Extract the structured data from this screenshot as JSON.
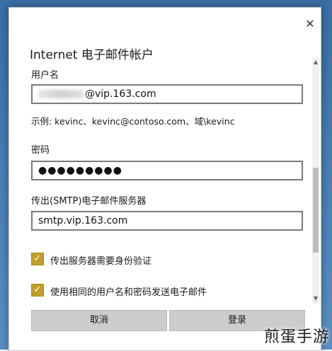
{
  "dialog": {
    "close_icon": "close-icon",
    "title": "Internet 电子邮件帐户"
  },
  "username": {
    "label": "用户名",
    "value_suffix": "@vip.163.com",
    "example": "示例: kevinc、kevinc@contoso.com、域\\kevinc"
  },
  "password": {
    "label": "密码",
    "value": "●●●●●●●●●"
  },
  "smtp": {
    "label": "传出(SMTP)电子邮件服务器",
    "value": "smtp.vip.163.com"
  },
  "options": [
    {
      "label": "传出服务器需要身份验证",
      "checked": true
    },
    {
      "label": "使用相同的用户名和密码发送电子邮件",
      "checked": true
    }
  ],
  "buttons": {
    "cancel": "取消",
    "login": "登录"
  },
  "watermark": "煎蛋手游",
  "colors": {
    "checkbox": "#c19f2a",
    "button": "#cccccc"
  }
}
